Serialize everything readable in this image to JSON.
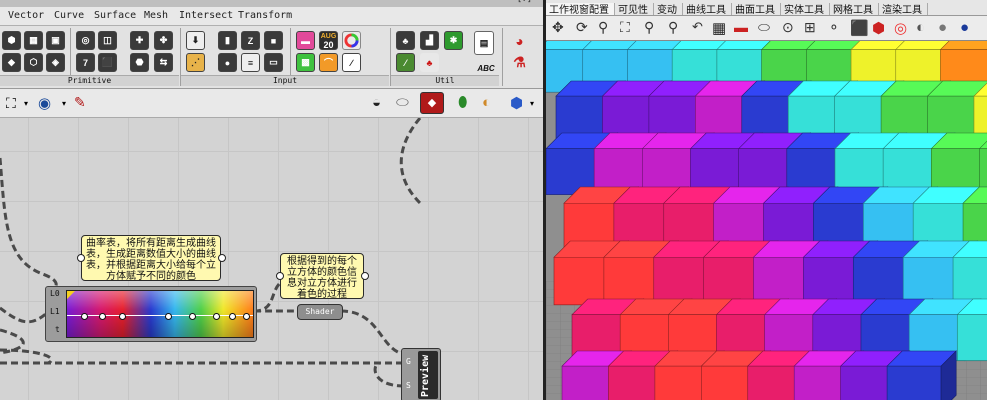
{
  "gh": {
    "title_text": "[?]",
    "menu": [
      "Vector",
      "Curve",
      "Surface",
      "Mesh",
      "Intersect",
      "Transform"
    ],
    "ribbon_groups": [
      "Primitive",
      "Input",
      "Util"
    ],
    "ribbon_calendar": {
      "month": "AUG",
      "day": "20"
    },
    "ribbon_abc": "ABC",
    "ribbon_numbers": [
      "7",
      "A",
      "Z"
    ],
    "notes": [
      "曲率表，将所有距离生成曲线表，生成距离数值大小的曲线表，并根据距离大小给每个立方体赋予不同的颜色",
      "根据得到的每个立方体的颜色信息对立方体进行着色的过程"
    ],
    "gradient_ports": [
      "L0",
      "L1",
      "t"
    ],
    "shader_label": "Shader",
    "preview_label": "Preview",
    "preview_ports": [
      "G",
      "S"
    ]
  },
  "rhino": {
    "tabs": [
      "工作视窗配置",
      "可见性",
      "变动",
      "曲线工具",
      "曲面工具",
      "实体工具",
      "网格工具",
      "渲染工具"
    ]
  },
  "colors": {
    "canvas": "#d3d3d3",
    "note_bg": "#fff9b0",
    "viewport_bg": "#8f8f8f",
    "cube_palette": [
      "#7a1bd6",
      "#c21fc8",
      "#e81e6a",
      "#ff3a3a",
      "#2a3bd0",
      "#36c0f2",
      "#36e0d8",
      "#4ad44a",
      "#eef22a",
      "#ff8a1a"
    ]
  }
}
